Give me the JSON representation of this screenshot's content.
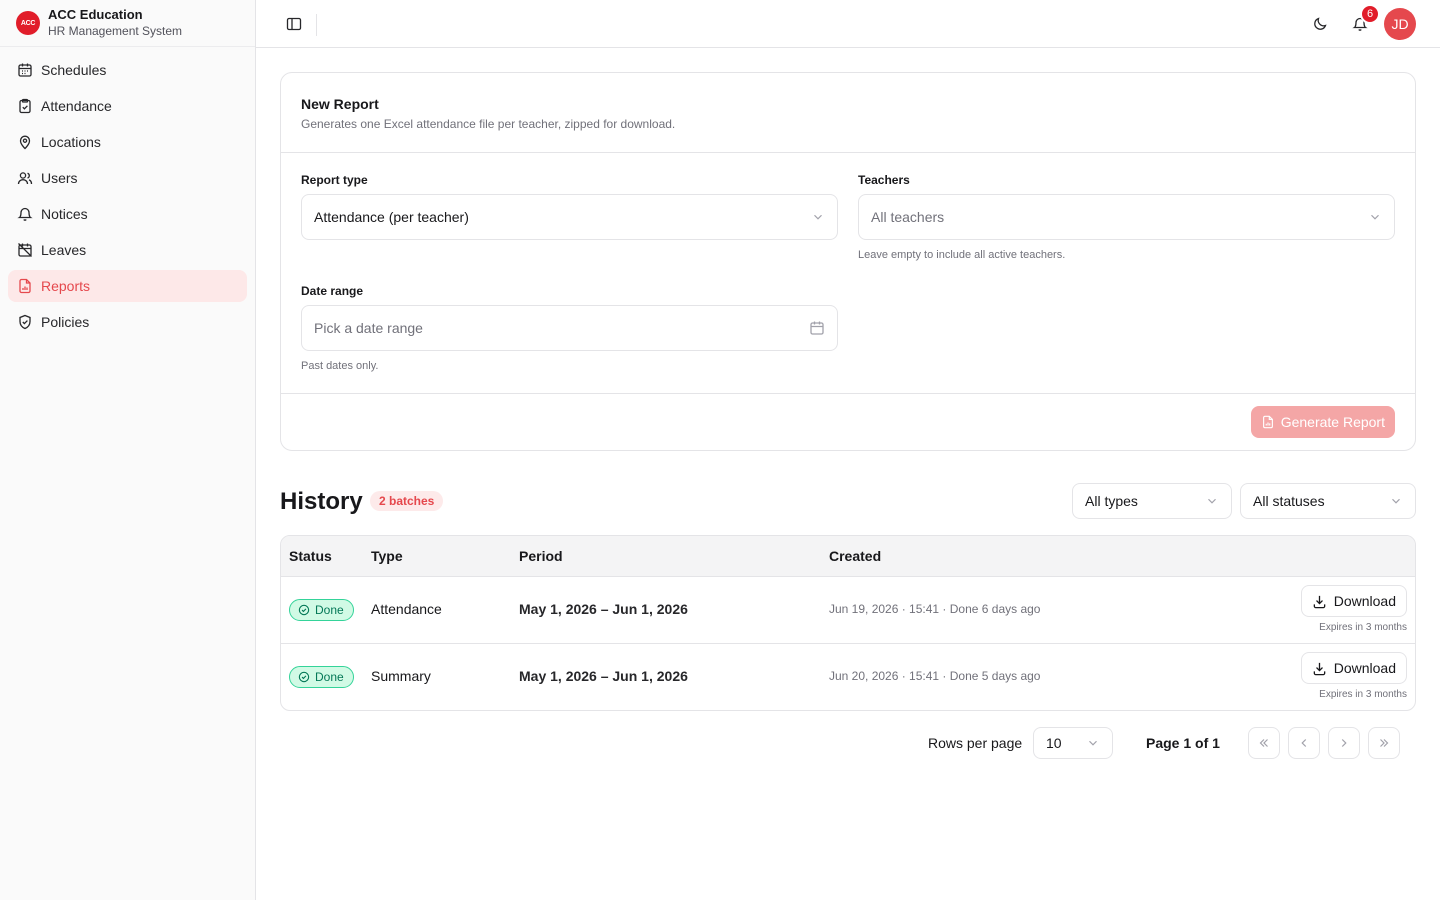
{
  "brand": {
    "logo_text": "ACC",
    "name": "ACC Education",
    "subtitle": "HR Management System"
  },
  "sidebar": {
    "items": [
      {
        "label": "Schedules",
        "icon": "calendar-icon"
      },
      {
        "label": "Attendance",
        "icon": "clipboard-check-icon"
      },
      {
        "label": "Locations",
        "icon": "map-pin-icon"
      },
      {
        "label": "Users",
        "icon": "users-icon"
      },
      {
        "label": "Notices",
        "icon": "bell-icon"
      },
      {
        "label": "Leaves",
        "icon": "calendar-off-icon"
      },
      {
        "label": "Reports",
        "icon": "file-chart-icon",
        "active": true
      },
      {
        "label": "Policies",
        "icon": "shield-check-icon"
      }
    ]
  },
  "header": {
    "notification_count": "6",
    "avatar_initials": "JD"
  },
  "new_report": {
    "title": "New Report",
    "description": "Generates one Excel attendance file per teacher, zipped for download.",
    "report_type_label": "Report type",
    "report_type_value": "Attendance (per teacher)",
    "teachers_label": "Teachers",
    "teachers_placeholder": "All teachers",
    "teachers_hint": "Leave empty to include all active teachers.",
    "date_range_label": "Date range",
    "date_range_placeholder": "Pick a date range",
    "date_range_hint": "Past dates only.",
    "generate_label": "Generate Report"
  },
  "history": {
    "title": "History",
    "badge": "2 batches",
    "filter_type": "All types",
    "filter_status": "All statuses",
    "columns": [
      "Status",
      "Type",
      "Period",
      "Created"
    ],
    "rows": [
      {
        "status": "Done",
        "type": "Attendance",
        "period": "May 1, 2026 – Jun 1, 2026",
        "created": "Jun 19, 2026 · 15:41 · Done 6 days ago",
        "download_label": "Download",
        "expires": "Expires in 3 months"
      },
      {
        "status": "Done",
        "type": "Summary",
        "period": "May 1, 2026 – Jun 1, 2026",
        "created": "Jun 20, 2026 · 15:41 · Done 5 days ago",
        "download_label": "Download",
        "expires": "Expires in 3 months"
      }
    ]
  },
  "pagination": {
    "rows_per_page_label": "Rows per page",
    "rows_per_page_value": "10",
    "page_label": "Page 1 of 1"
  },
  "colors": {
    "accent": "#e5484d",
    "accent_soft": "#fde8e8",
    "success": "#047857"
  }
}
